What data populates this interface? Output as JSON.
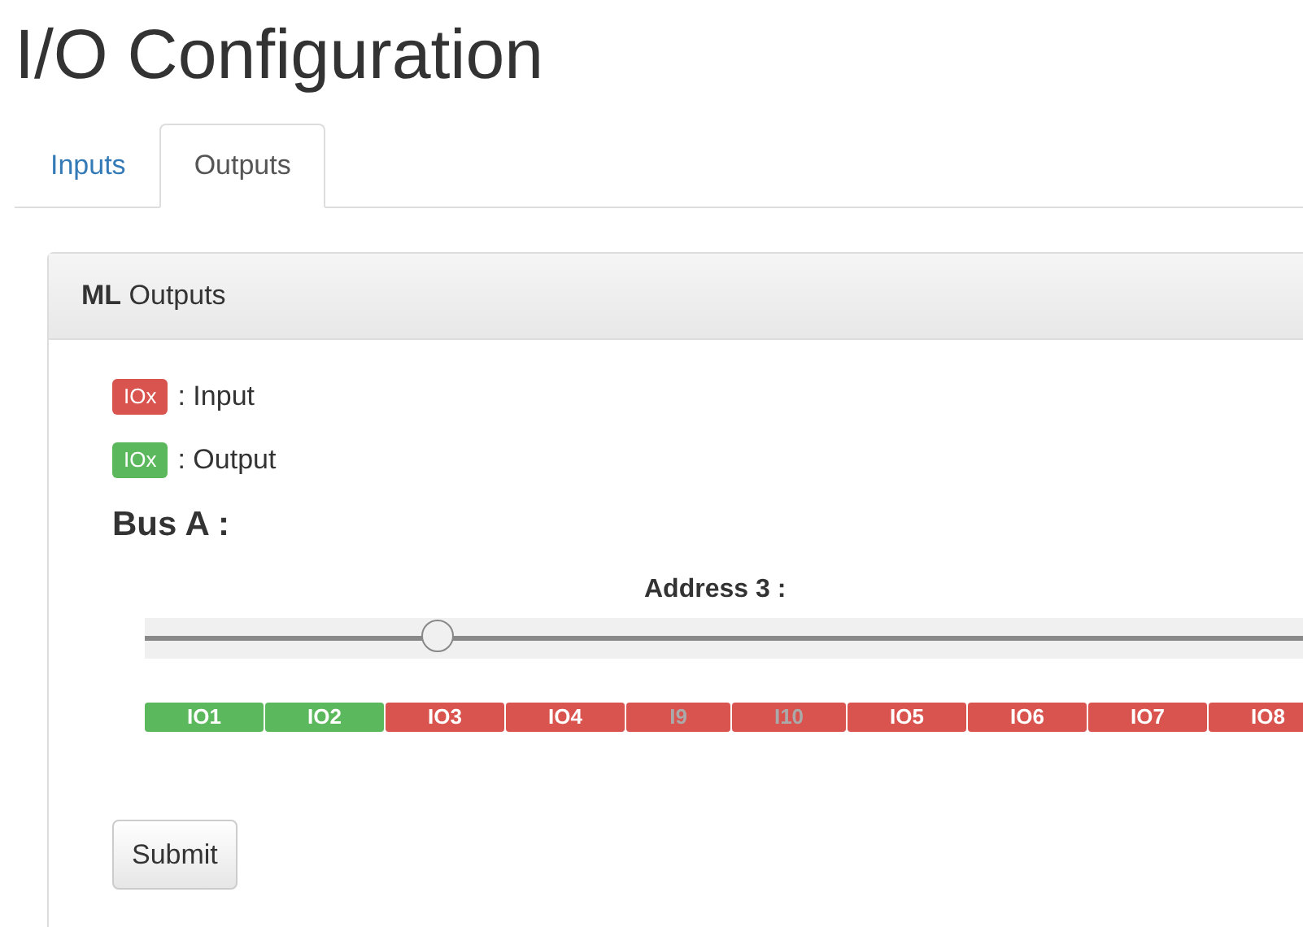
{
  "title": "I/O Configuration",
  "tabs": [
    {
      "label": "Inputs",
      "selected": false
    },
    {
      "label": "Outputs",
      "selected": true
    }
  ],
  "panel": {
    "heading": "**ML** Outputs",
    "legend": [
      {
        "badge": "IOx",
        "kind": "input",
        "label": ": Input"
      },
      {
        "badge": "IOx",
        "kind": "output",
        "label": ": Output"
      }
    ],
    "bus": "Bus A :",
    "address": "Address 3 :",
    "slider": {
      "level": 0.2
    },
    "segments": [
      {
        "label": "IO1",
        "kind": "output",
        "disabled": false
      },
      {
        "label": "IO2",
        "kind": "output",
        "disabled": false
      },
      {
        "label": "IO3",
        "kind": "input",
        "disabled": false
      },
      {
        "label": "IO4",
        "kind": "input",
        "disabled": false
      },
      {
        "label": "I9",
        "kind": "input",
        "disabled": true
      },
      {
        "label": "I10",
        "kind": "input",
        "disabled": true
      },
      {
        "label": "IO5",
        "kind": "input",
        "disabled": false
      },
      {
        "label": "IO6",
        "kind": "input",
        "disabled": false
      },
      {
        "label": "IO7",
        "kind": "input",
        "disabled": false
      },
      {
        "label": "IO8",
        "kind": "input",
        "disabled": false
      }
    ],
    "submit": "Submit"
  }
}
